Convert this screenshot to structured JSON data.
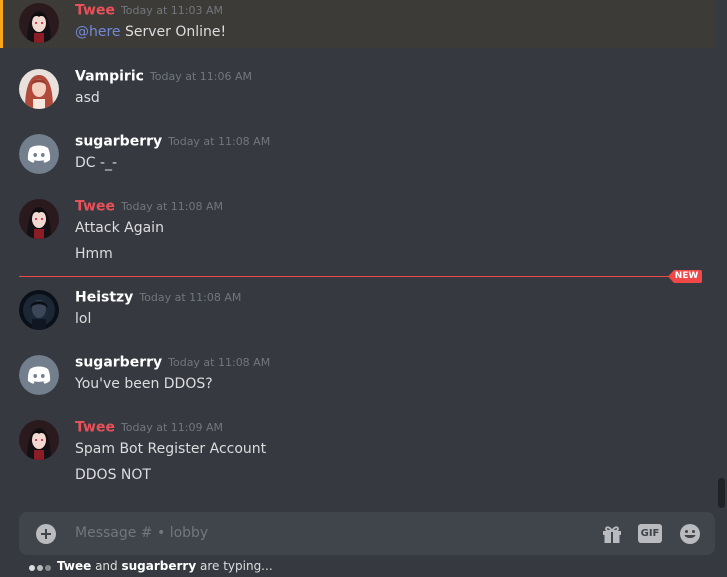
{
  "messages": [
    {
      "username": "Twee",
      "timestamp": "Today at 11:03 AM",
      "mention": "@here",
      "text": "Server Online!",
      "avatar": "twee-avatar"
    },
    {
      "username": "Vampiric",
      "timestamp": "Today at 11:06 AM",
      "text": "asd",
      "avatar": "vampiric-avatar"
    },
    {
      "username": "sugarberry",
      "timestamp": "Today at 11:08 AM",
      "text": "DC -_-",
      "avatar": "discord-default-avatar"
    },
    {
      "username": "Twee",
      "timestamp": "Today at 11:08 AM",
      "lines": [
        "Attack Again",
        "Hmm"
      ],
      "avatar": "twee-avatar"
    },
    {
      "username": "Heistzy",
      "timestamp": "Today at 11:08 AM",
      "text": "lol",
      "avatar": "heistzy-avatar"
    },
    {
      "username": "sugarberry",
      "timestamp": "Today at 11:08 AM",
      "text": "You've been DDOS?",
      "avatar": "discord-default-avatar"
    },
    {
      "username": "Twee",
      "timestamp": "Today at 11:09 AM",
      "lines": [
        "Spam Bot Register Account",
        "DDOS NOT"
      ],
      "avatar": "twee-avatar"
    }
  ],
  "new_divider": {
    "label": "NEW",
    "color": "#f04747"
  },
  "composer": {
    "placeholder": "Message # • lobby",
    "gif_label": "GIF",
    "icons": [
      "add-icon",
      "gift-icon",
      "gif-icon",
      "emoji-icon"
    ]
  },
  "typing": {
    "user1": "Twee",
    "and": "and",
    "user2": "sugarberry",
    "suffix": "are typing..."
  },
  "colors": {
    "background": "#36393f",
    "composer_bg": "#40444b",
    "username_red": "#e8515a",
    "mention_blue": "#7289da",
    "mention_highlight_border": "#faa61a",
    "timestamp": "#72767d",
    "text": "#dcddde"
  }
}
